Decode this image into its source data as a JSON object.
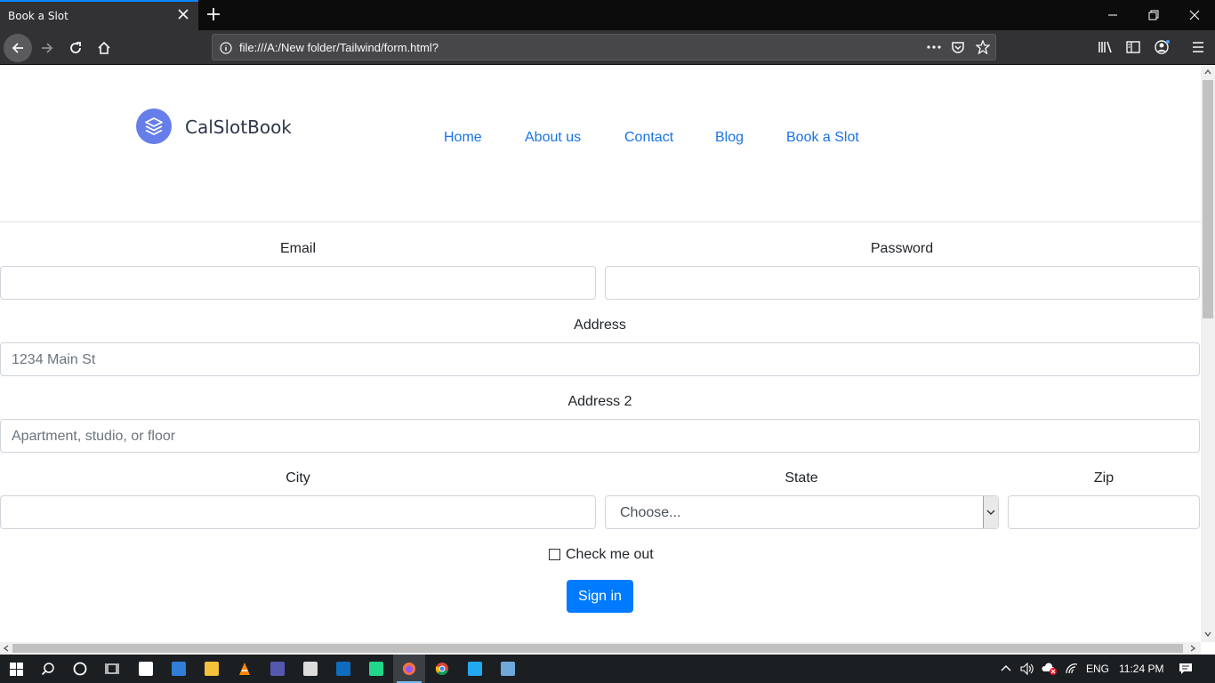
{
  "browser": {
    "tab_title": "Book a Slot",
    "url": "file:///A:/New folder/Tailwind/form.html?"
  },
  "site": {
    "brand": "CalSlotBook",
    "nav": [
      "Home",
      "About us",
      "Contact",
      "Blog",
      "Book a Slot"
    ]
  },
  "form": {
    "email_label": "Email",
    "password_label": "Password",
    "address_label": "Address",
    "address_placeholder": "1234 Main St",
    "address2_label": "Address 2",
    "address2_placeholder": "Apartment, studio, or floor",
    "city_label": "City",
    "state_label": "State",
    "state_selected": "Choose...",
    "zip_label": "Zip",
    "checkbox_label": "Check me out",
    "submit_label": "Sign in"
  },
  "taskbar": {
    "language": "ENG",
    "time": "11:24 PM"
  },
  "colors": {
    "link": "#1a73e8",
    "primary_button": "#007bff",
    "logo": "#667eea"
  }
}
